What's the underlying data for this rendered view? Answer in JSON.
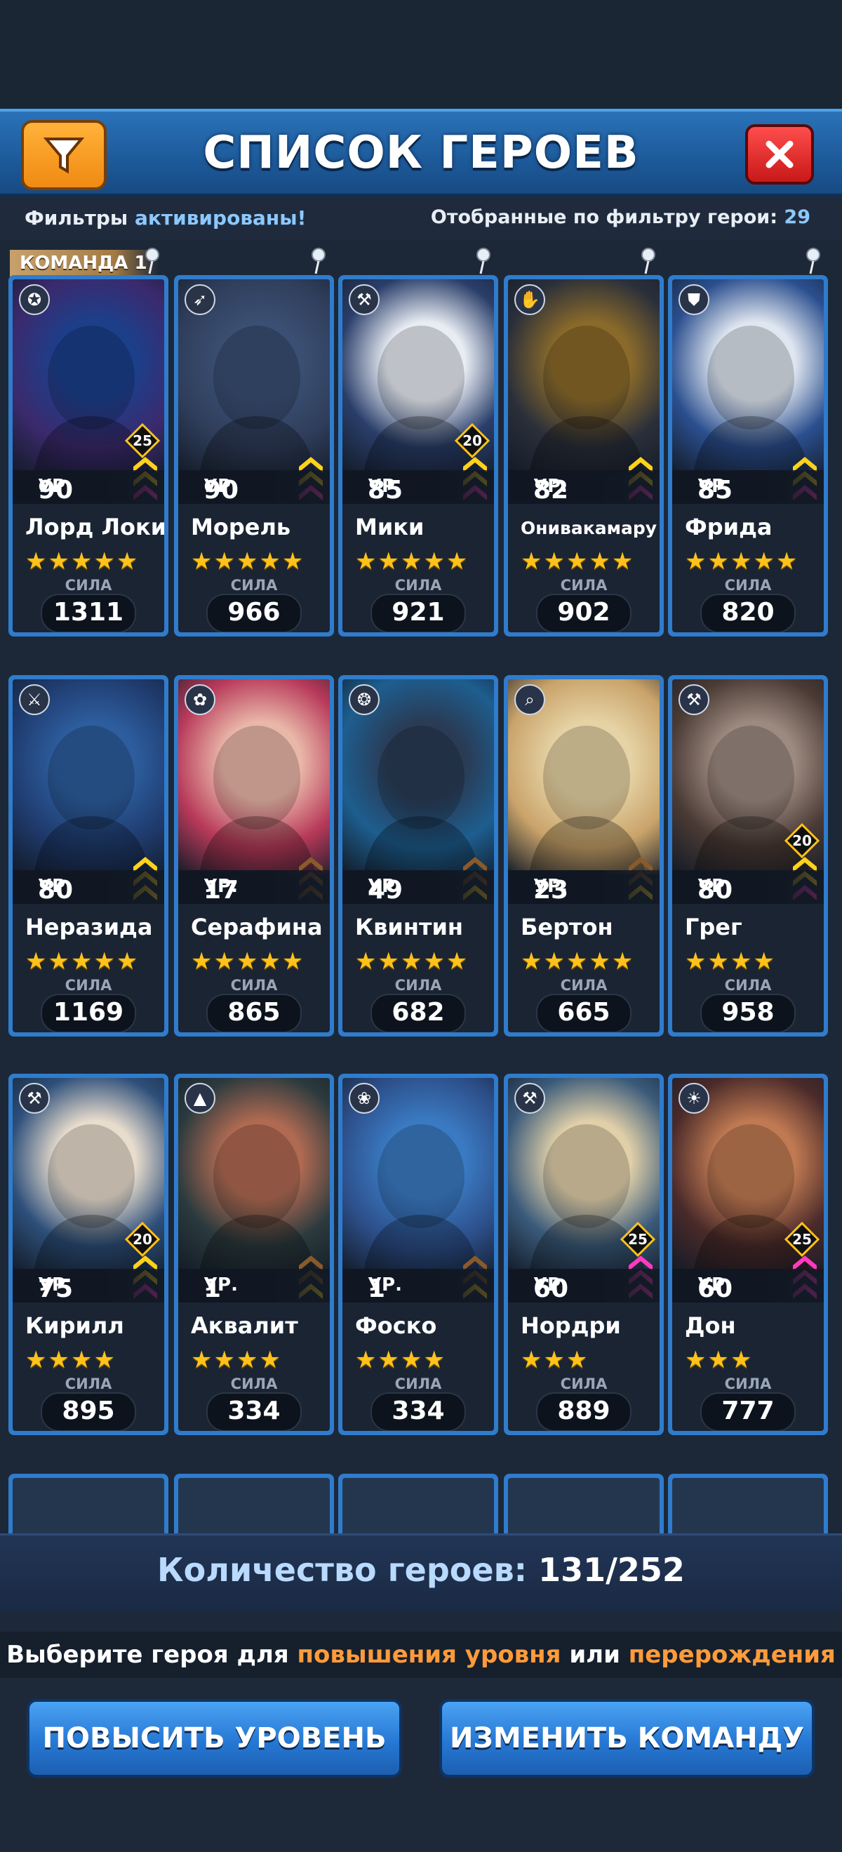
{
  "header": {
    "title": "СПИСОК ГЕРОЕВ"
  },
  "info": {
    "filters_prefix": "Фильтры",
    "filters_status": "активированы!",
    "filtered_label": "Отобранные по фильтру герои:",
    "filtered_count": "29"
  },
  "team_tag": "КОМАНДА 1",
  "level_prefix": "УР.",
  "power_label": "СИЛА",
  "heroes": [
    {
      "name": "Лорд Локи",
      "level": "90",
      "stars": "★★★★★",
      "power": "1311",
      "badge": "25",
      "class": "pentagram-icon"
    },
    {
      "name": "Морель",
      "level": "90",
      "stars": "★★★★★",
      "power": "966",
      "badge": "",
      "class": "bow-icon"
    },
    {
      "name": "Мики",
      "level": "85",
      "stars": "★★★★★",
      "power": "921",
      "badge": "20",
      "class": "hammer-icon"
    },
    {
      "name": "Онивакамару",
      "level": "82",
      "stars": "★★★★★",
      "power": "902",
      "badge": "",
      "class": "hand-icon"
    },
    {
      "name": "Фрида",
      "level": "85",
      "stars": "★★★★★",
      "power": "820",
      "badge": "",
      "class": "shield-icon"
    },
    {
      "name": "Неразида",
      "level": "80",
      "stars": "★★★★★",
      "power": "1169",
      "badge": "",
      "class": "swords-icon"
    },
    {
      "name": "Серафина",
      "level": "17",
      "stars": "★★★★★",
      "power": "865",
      "badge": "",
      "class": "rose-icon"
    },
    {
      "name": "Квинтин",
      "level": "49",
      "stars": "★★★★★",
      "power": "682",
      "badge": "",
      "class": "spirit-icon"
    },
    {
      "name": "Бертон",
      "level": "23",
      "stars": "★★★★★",
      "power": "665",
      "badge": "",
      "class": "magnifier-icon"
    },
    {
      "name": "Грег",
      "level": "80",
      "stars": "★★★★",
      "power": "958",
      "badge": "20",
      "class": "hammer-icon"
    },
    {
      "name": "Кирилл",
      "level": "75",
      "stars": "★★★★",
      "power": "895",
      "badge": "20",
      "class": "hammer-icon"
    },
    {
      "name": "Аквалит",
      "level": "1",
      "stars": "★★★★",
      "power": "334",
      "badge": "",
      "class": "triangle-icon"
    },
    {
      "name": "Фоско",
      "level": "1",
      "stars": "★★★★",
      "power": "334",
      "badge": "",
      "class": "flower-icon"
    },
    {
      "name": "Нордри",
      "level": "60",
      "stars": "★★★",
      "power": "889",
      "badge": "25",
      "class": "hammer-icon"
    },
    {
      "name": "Дон",
      "level": "60",
      "stars": "★★★",
      "power": "777",
      "badge": "25",
      "class": "sun-icon"
    }
  ],
  "footer": {
    "count_label": "Количество героев:",
    "count_value": "131/252",
    "hint_start": "Выберите героя для",
    "hint_level": "повышения уровня",
    "hint_or": "или",
    "hint_rebirth": "перерождения",
    "btn_level_up": "ПОВЫСИТЬ УРОВЕНЬ",
    "btn_change_team": "ИЗМЕНИТЬ КОМАНДУ"
  },
  "colors": {
    "accent": "#2f7ccd",
    "orange": "#ff9b3a",
    "header": "#1d5a9a",
    "gold": "#ffc21a"
  }
}
